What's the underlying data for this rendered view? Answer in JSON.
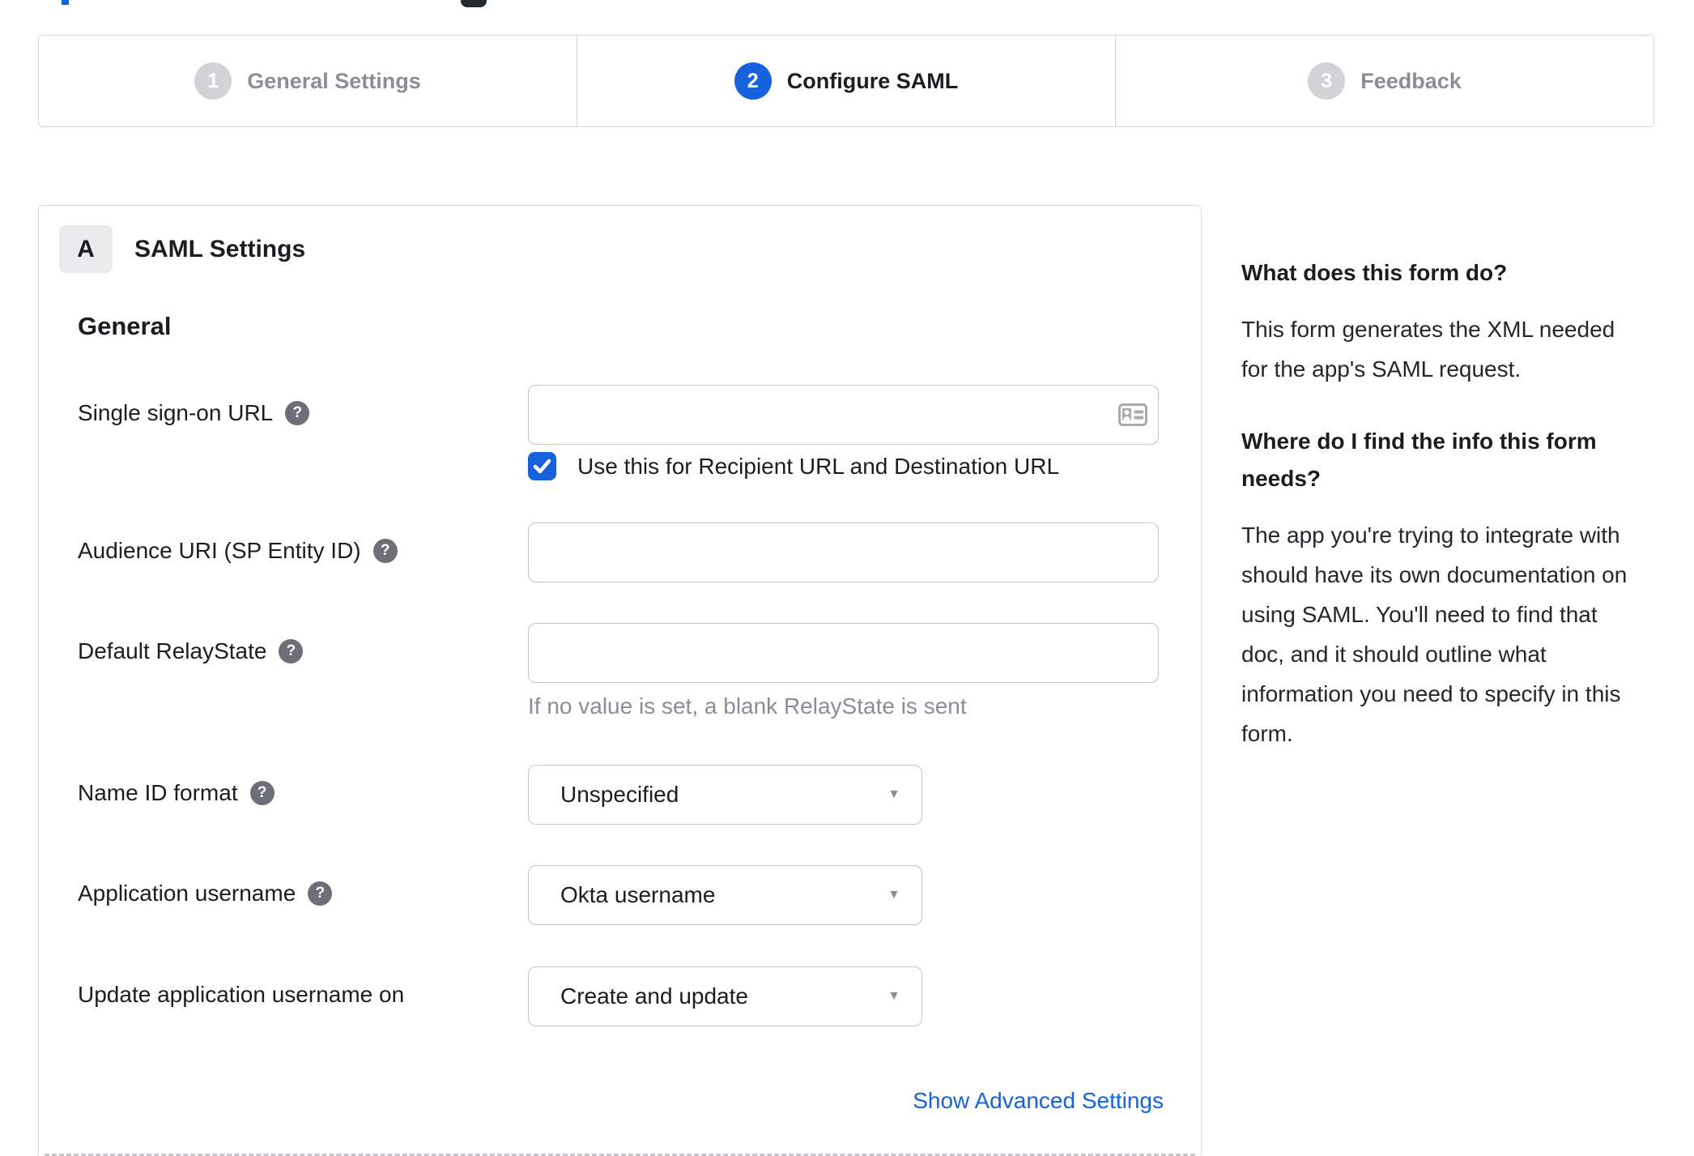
{
  "stepper": {
    "steps": [
      {
        "number": "1",
        "label": "General Settings",
        "state": "inactive"
      },
      {
        "number": "2",
        "label": "Configure SAML",
        "state": "active"
      },
      {
        "number": "3",
        "label": "Feedback",
        "state": "inactive"
      }
    ]
  },
  "panel": {
    "badge": "A",
    "title": "SAML Settings",
    "section_heading": "General",
    "fields": {
      "sso_url": {
        "label": "Single sign-on URL",
        "value": ""
      },
      "sso_checkbox": {
        "label": "Use this for Recipient URL and Destination URL",
        "checked": true
      },
      "audience_uri": {
        "label": "Audience URI (SP Entity ID)",
        "value": ""
      },
      "relay_state": {
        "label": "Default RelayState",
        "value": "",
        "hint": "If no value is set, a blank RelayState is sent"
      },
      "name_id_format": {
        "label": "Name ID format",
        "value": "Unspecified"
      },
      "app_username": {
        "label": "Application username",
        "value": "Okta username"
      },
      "update_app_username": {
        "label": "Update application username on",
        "value": "Create and update"
      }
    },
    "advanced_link": "Show Advanced Settings"
  },
  "sidebar": {
    "q1": {
      "heading": "What does this form do?",
      "body": "This form generates the XML needed\nfor the app's SAML request."
    },
    "q2": {
      "heading": "Where do I find the info this form\nneeds?",
      "body": "The app you're trying to integrate with\nshould have its own documentation on\nusing SAML. You'll need to find that\ndoc, and it should outline what\ninformation you need to specify in this\nform."
    }
  },
  "icons": {
    "help_glyph": "?",
    "caret_glyph": "▼"
  },
  "colors": {
    "accent_blue": "#1662dd",
    "inactive_gray": "#d3d3d7",
    "border_gray": "#d8d8dc"
  }
}
